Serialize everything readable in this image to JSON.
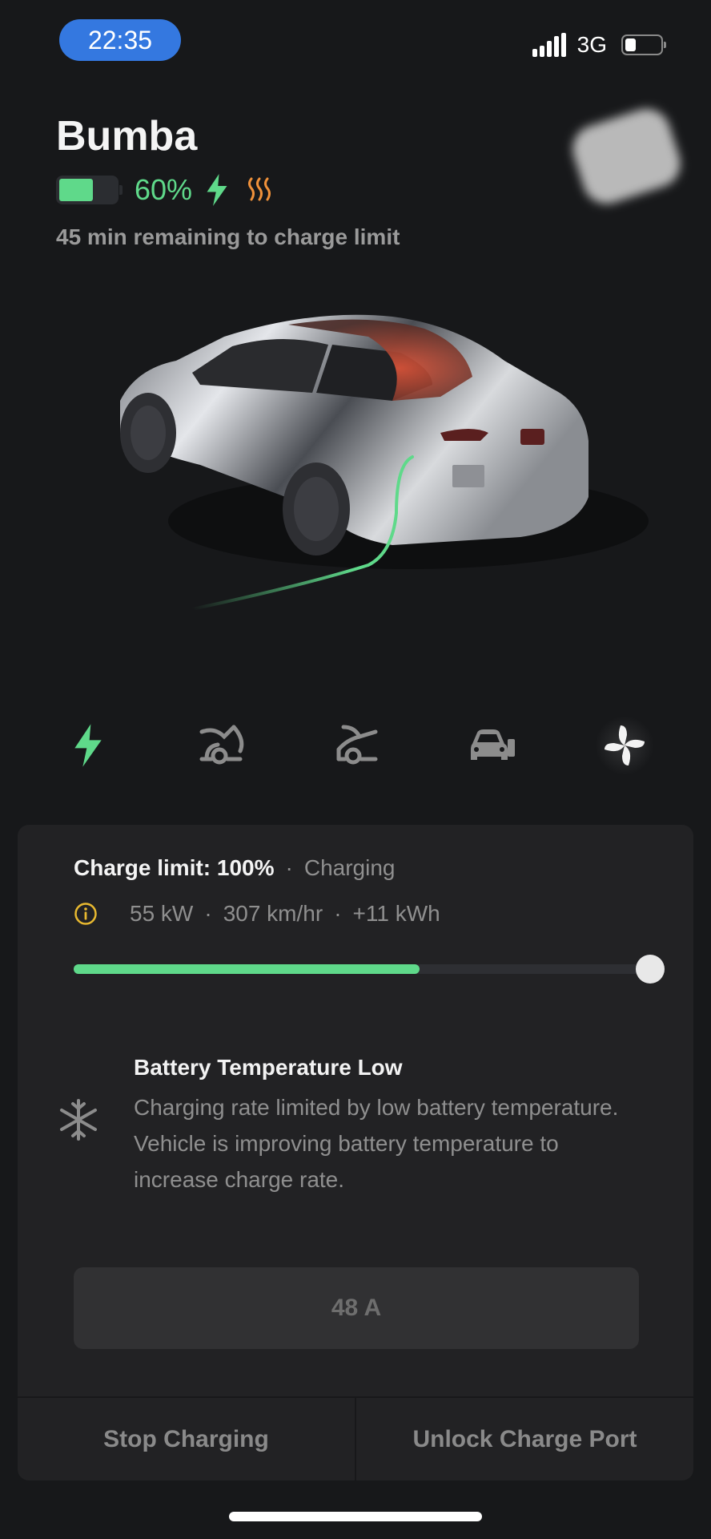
{
  "status_bar": {
    "time": "22:35",
    "network": "3G",
    "signal_icon": "signal-bars-icon",
    "battery_icon": "phone-battery-icon",
    "phone_battery_level": 0.3
  },
  "vehicle": {
    "name": "Bumba",
    "battery_percent": "60%",
    "battery_level": 0.6,
    "charging_icon": "lightning-bolt-icon",
    "heating_icon": "battery-heat-icon",
    "remaining_text": "45 min remaining to charge limit",
    "image": "car-3d-render"
  },
  "quick_controls": [
    {
      "name": "charging",
      "icon": "lightning-bolt-icon",
      "active": true
    },
    {
      "name": "frunk",
      "icon": "frunk-open-icon"
    },
    {
      "name": "trunk",
      "icon": "trunk-open-icon"
    },
    {
      "name": "vent",
      "icon": "car-vent-icon"
    },
    {
      "name": "climate",
      "icon": "fan-icon"
    }
  ],
  "charging_card": {
    "limit_label": "Charge limit: 100%",
    "separator": "·",
    "state": "Charging",
    "power": "55 kW",
    "rate": "307 km/hr",
    "energy_added": "+11 kWh",
    "info_icon": "info-icon",
    "charge_level": 0.6,
    "charge_limit": 1.0,
    "warning": {
      "icon": "snowflake-icon",
      "title": "Battery Temperature Low",
      "body": "Charging rate limited by low battery temperature. Vehicle is improving battery temperature to increase charge rate."
    },
    "current_value": "48 A",
    "buttons": {
      "stop": "Stop Charging",
      "unlock": "Unlock Charge Port"
    }
  },
  "colors": {
    "accent_green": "#5fd98a",
    "heat_orange": "#f0913a",
    "info_yellow": "#e8b930",
    "time_pill_blue": "#3478e0"
  }
}
